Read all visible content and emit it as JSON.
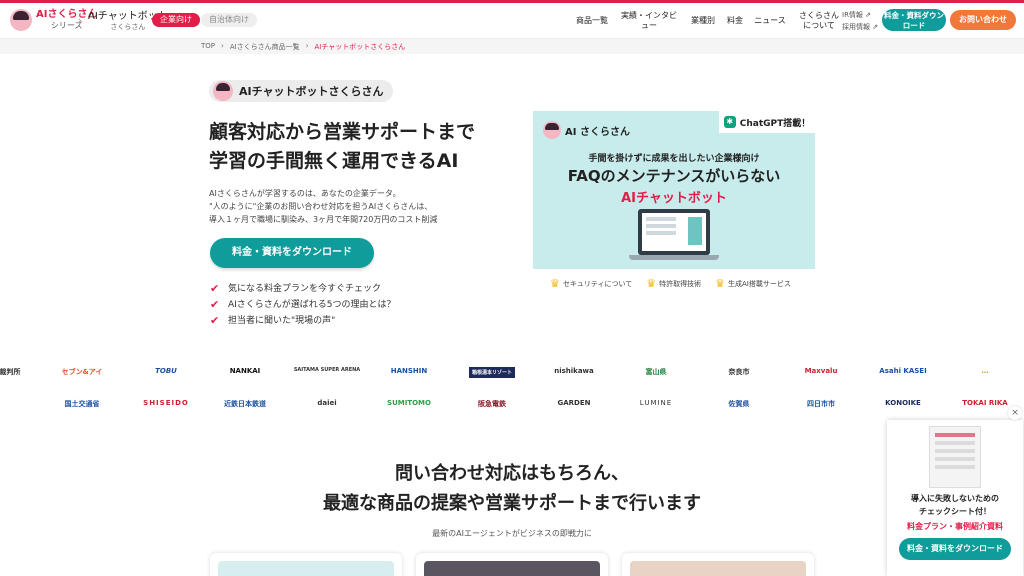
{
  "header": {
    "logo_line1": "AIさくらさん",
    "logo_line2": "シリーズ",
    "product_name": "AIチャットボット",
    "product_sub": "さくらさん",
    "pill_business": "企業向け",
    "pill_government": "自治体向け",
    "nav": [
      "商品一覧",
      "実績・インタビュー",
      "業種別",
      "料金",
      "ニュース",
      "さくらさんについて"
    ],
    "ir_link": "IR情報",
    "recruit_link": "採用情報",
    "download_btn": "料金・資料ダウンロード",
    "contact_btn": "お問い合わせ"
  },
  "breadcrumb": [
    "TOP",
    "AIさくらさん商品一覧",
    "AIチャットボットさくらさん"
  ],
  "hero": {
    "tag": "AIチャットボットさくらさん",
    "title_line1": "顧客対応から営業サポートまで",
    "title_line2": "学習の手間無く運用できるAI",
    "desc_line1": "AIさくらさんが学習するのは、あなたの企業データ。",
    "desc_line2": "\"人のように\"企業のお問い合わせ対応を担うAIさくらさんは、",
    "desc_line3": "導入１ヶ月で職場に馴染み、3ヶ月で年間720万円のコスト削減",
    "cta": "料金・資料をダウンロード",
    "checks": [
      "気になる料金プランを今すぐチェック",
      "AIさくらさんが選ばれる5つの理由とは？",
      "担当者に聞いた\"現場の声\""
    ]
  },
  "banner": {
    "logo": "AI さくらさん",
    "gpt_badge": "ChatGPT搭載！",
    "line1": "手間を掛けずに成果を出したい企業様向け",
    "line2": "FAQのメンテナンスがいらない",
    "line3": "AIチャットボット",
    "features": [
      "セキュリティについて",
      "特許取得技術",
      "生成AI搭載サービス"
    ]
  },
  "logos": {
    "row1": [
      "裁判所",
      "セブン&アイ",
      "TOBU",
      "NANKAI",
      "SAITAMA SUPER ARENA",
      "HANSHIN",
      "箱根湯本リゾート",
      "nishikawa",
      "富山県",
      "奈良市",
      "Maxvalu",
      "Asahi KASEI",
      "…"
    ],
    "row2": [
      "国土交通省",
      "SHISEIDO",
      "近鉄日本鉄道",
      "daiei",
      "SUMITOMO",
      "阪急電鉄",
      "GARDEN",
      "LUMINE",
      "佐賀県",
      "四日市市",
      "KONOIKE",
      "TOKAI RIKA"
    ]
  },
  "section": {
    "title_line1": "問い合わせ対応はもちろん、",
    "title_line2": "最適な商品の提案や営業サポートまで行います",
    "subtitle": "最新のAIエージェントがビジネスの即戦力に"
  },
  "popup": {
    "close": "×",
    "text1": "導入に失敗しないための",
    "text2": "チェックシート付！",
    "text3": "料金プラン・事例紹介資料",
    "button": "料金・資料をダウンロード"
  },
  "colors": {
    "accent": "#e11d48",
    "teal": "#0f9c9a",
    "orange": "#f2783a"
  }
}
